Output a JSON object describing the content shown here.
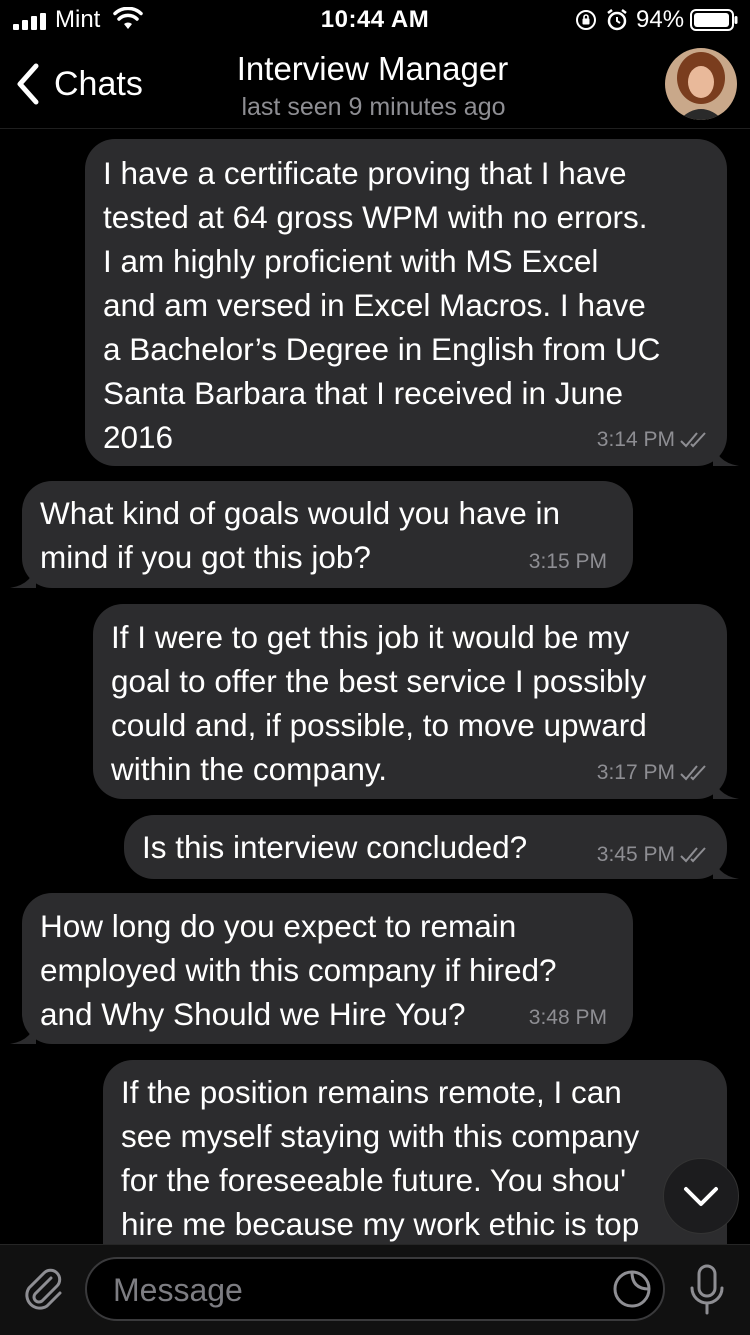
{
  "status_bar": {
    "carrier": "Mint",
    "time": "10:44 AM",
    "battery": "94%"
  },
  "header": {
    "back_label": "Chats",
    "title": "Interview Manager",
    "subtitle": "last seen 9 minutes ago"
  },
  "messages": [
    {
      "direction": "outgoing",
      "text": "I have a certificate proving that I have\ntested at 64 gross WPM with no errors.\nI am highly proficient with MS Excel\nand am versed in Excel Macros. I have\na Bachelor’s Degree in English from UC\nSanta Barbara that I received in June\n2016",
      "time": "3:14 PM",
      "status": "read"
    },
    {
      "direction": "incoming",
      "text": "What kind of goals would you have in\nmind if you got this job?",
      "time": "3:15 PM"
    },
    {
      "direction": "outgoing",
      "text": "If I were to get this job it would be my\ngoal to offer the best service I possibly\ncould and, if possible, to move upward\nwithin the company.",
      "time": "3:17 PM",
      "status": "read"
    },
    {
      "direction": "outgoing",
      "text": "Is this interview concluded?",
      "time": "3:45 PM",
      "status": "read"
    },
    {
      "direction": "incoming",
      "text": "How long do you expect to remain\nemployed with this company if hired?\nand Why Should we Hire You?",
      "time": "3:48 PM"
    },
    {
      "direction": "outgoing",
      "text": "If the position remains remote, I can\nsee myself staying with this company\nfor the foreseeable future. You shou'\nhire me because my work ethic is top"
    }
  ],
  "input": {
    "placeholder": "Message"
  },
  "colors": {
    "background": "#000000",
    "bubble": "#2c2c2e",
    "meta_text": "#8e8e93"
  },
  "icons": [
    "signal-icon",
    "wifi-icon",
    "rotation-lock-icon",
    "alarm-icon",
    "battery-icon",
    "back-chevron-icon",
    "double-check-icon",
    "chevron-down-icon",
    "paperclip-icon",
    "sticker-icon",
    "microphone-icon"
  ]
}
